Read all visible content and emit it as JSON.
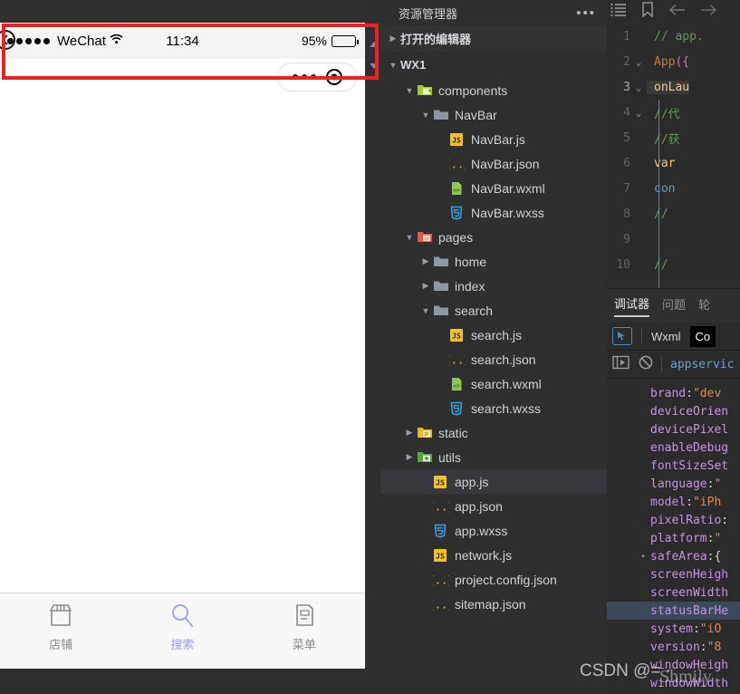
{
  "simulator": {
    "status_bar": {
      "signal_dots": 5,
      "carrier": "WeChat",
      "time": "11:34",
      "battery_percent": "95%",
      "battery_level": 0.95,
      "back_icon": "back-arrow-circle-icon",
      "wifi_icon": "wifi-icon"
    },
    "capsule": {
      "menu_icon": "more-dots-icon",
      "close_icon": "close-target-icon"
    },
    "tabbar": [
      {
        "label": "店铺",
        "icon": "shop-icon",
        "active": false
      },
      {
        "label": "搜索",
        "icon": "search-icon",
        "active": true
      },
      {
        "label": "菜单",
        "icon": "menu-doc-icon",
        "active": false
      }
    ]
  },
  "explorer": {
    "title": "资源管理器",
    "more_icon": "ellipsis-icon",
    "sections": [
      {
        "label": "打开的编辑器",
        "expanded": false
      },
      {
        "label": "WX1",
        "expanded": true
      }
    ],
    "tree": [
      {
        "label": "components",
        "type": "folder-green",
        "depth": 1,
        "expanded": true,
        "selected": false
      },
      {
        "label": "NavBar",
        "type": "folder-plain",
        "depth": 2,
        "expanded": true,
        "selected": false
      },
      {
        "label": "NavBar.js",
        "type": "js",
        "depth": 3,
        "selected": false
      },
      {
        "label": "NavBar.json",
        "type": "json",
        "depth": 3,
        "selected": false
      },
      {
        "label": "NavBar.wxml",
        "type": "wxml",
        "depth": 3,
        "selected": false
      },
      {
        "label": "NavBar.wxss",
        "type": "wxss",
        "depth": 3,
        "selected": false
      },
      {
        "label": "pages",
        "type": "folder-red",
        "depth": 1,
        "expanded": true,
        "selected": false
      },
      {
        "label": "home",
        "type": "folder-plain",
        "depth": 2,
        "expanded": false,
        "selected": false
      },
      {
        "label": "index",
        "type": "folder-plain",
        "depth": 2,
        "expanded": false,
        "selected": false
      },
      {
        "label": "search",
        "type": "folder-plain",
        "depth": 2,
        "expanded": true,
        "selected": false
      },
      {
        "label": "search.js",
        "type": "js",
        "depth": 3,
        "selected": false
      },
      {
        "label": "search.json",
        "type": "json",
        "depth": 3,
        "selected": false
      },
      {
        "label": "search.wxml",
        "type": "wxml",
        "depth": 3,
        "selected": false
      },
      {
        "label": "search.wxss",
        "type": "wxss",
        "depth": 3,
        "selected": false
      },
      {
        "label": "static",
        "type": "folder-yellow",
        "depth": 1,
        "expanded": false,
        "selected": false
      },
      {
        "label": "utils",
        "type": "folder-green2",
        "depth": 1,
        "expanded": false,
        "selected": false
      },
      {
        "label": "app.js",
        "type": "js",
        "depth": 2,
        "selected": true
      },
      {
        "label": "app.json",
        "type": "json",
        "depth": 2,
        "selected": false
      },
      {
        "label": "app.wxss",
        "type": "wxss",
        "depth": 2,
        "selected": false
      },
      {
        "label": "network.js",
        "type": "js",
        "depth": 2,
        "selected": false
      },
      {
        "label": "project.config.json",
        "type": "json",
        "depth": 2,
        "selected": false
      },
      {
        "label": "sitemap.json",
        "type": "json",
        "depth": 2,
        "selected": false
      }
    ]
  },
  "editor": {
    "toolbar_icons": [
      "outline-list-icon",
      "bookmark-icon",
      "back-arrow-icon",
      "forward-arrow-icon"
    ],
    "lines": [
      {
        "num": "1",
        "fold": "",
        "current": false,
        "tokens": [
          {
            "t": "// app.",
            "c": "k-comment"
          }
        ]
      },
      {
        "num": "2",
        "fold": "v",
        "current": false,
        "tokens": [
          {
            "t": "App",
            "c": "k-kw"
          },
          {
            "t": "({",
            "c": "k-brace"
          }
        ]
      },
      {
        "num": "3",
        "fold": "v",
        "current": true,
        "tokens": [
          {
            "t": "  onLau",
            "c": "k-fn"
          }
        ]
      },
      {
        "num": "4",
        "fold": "v",
        "current": false,
        "tokens": [
          {
            "t": "    //代",
            "c": "k-comment"
          }
        ]
      },
      {
        "num": "5",
        "fold": "",
        "current": false,
        "tokens": [
          {
            "t": "    //获",
            "c": "k-comment"
          }
        ]
      },
      {
        "num": "6",
        "fold": "",
        "current": false,
        "tokens": [
          {
            "t": "    var",
            "c": "k-fn"
          }
        ]
      },
      {
        "num": "7",
        "fold": "",
        "current": false,
        "tokens": [
          {
            "t": "    con",
            "c": "k-blue"
          }
        ]
      },
      {
        "num": "8",
        "fold": "",
        "current": false,
        "tokens": [
          {
            "t": "    // ",
            "c": "k-comment"
          }
        ]
      },
      {
        "num": "9",
        "fold": "",
        "current": false,
        "tokens": [
          {
            "t": "",
            "c": "k-plain"
          }
        ]
      },
      {
        "num": "10",
        "fold": "",
        "current": false,
        "tokens": [
          {
            "t": "    // ",
            "c": "k-comment"
          }
        ]
      }
    ]
  },
  "debugger": {
    "tabs": [
      {
        "label": "调试器",
        "active": true
      },
      {
        "label": "问题",
        "active": false
      },
      {
        "label": "轮",
        "active": false
      }
    ],
    "subbar": {
      "inspect_icon": "element-picker-icon",
      "items": [
        {
          "label": "Wxml",
          "selected": false
        },
        {
          "label": "Co",
          "selected": true
        }
      ]
    },
    "console_bar": {
      "step_icon": "step-into-icon",
      "clear_icon": "clear-console-icon",
      "context": "appservic"
    },
    "object_rows": [
      {
        "arrow": "",
        "key": "brand",
        "sep": ": ",
        "val": "\"dev",
        "valclass": "o-str",
        "highlight": false
      },
      {
        "arrow": "",
        "key": "deviceOrien",
        "sep": "",
        "val": "",
        "valclass": "o-str",
        "highlight": false
      },
      {
        "arrow": "",
        "key": "devicePixel",
        "sep": "",
        "val": "",
        "valclass": "o-str",
        "highlight": false
      },
      {
        "arrow": "",
        "key": "enableDebug",
        "sep": "",
        "val": "",
        "valclass": "o-str",
        "highlight": false
      },
      {
        "arrow": "",
        "key": "fontSizeSet",
        "sep": "",
        "val": "",
        "valclass": "o-str",
        "highlight": false
      },
      {
        "arrow": "",
        "key": "language",
        "sep": ": ",
        "val": "\"",
        "valclass": "o-str",
        "highlight": false
      },
      {
        "arrow": "",
        "key": "model",
        "sep": ": ",
        "val": "\"iPh",
        "valclass": "o-str",
        "highlight": false
      },
      {
        "arrow": "",
        "key": "pixelRatio",
        "sep": ":",
        "val": "",
        "valclass": "o-num",
        "highlight": false
      },
      {
        "arrow": "",
        "key": "platform",
        "sep": ": ",
        "val": "\"",
        "valclass": "o-str",
        "highlight": false
      },
      {
        "arrow": "▸",
        "key": "safeArea",
        "sep": ": ",
        "val": "{",
        "valclass": "o-punc",
        "highlight": false
      },
      {
        "arrow": "",
        "key": "screenHeigh",
        "sep": "",
        "val": "",
        "valclass": "o-num",
        "highlight": false
      },
      {
        "arrow": "",
        "key": "screenWidth",
        "sep": "",
        "val": "",
        "valclass": "o-num",
        "highlight": false
      },
      {
        "arrow": "",
        "key": "statusBarHe",
        "sep": "",
        "val": "",
        "valclass": "o-num",
        "highlight": true
      },
      {
        "arrow": "",
        "key": "system",
        "sep": ": ",
        "val": "\"iO",
        "valclass": "o-str",
        "highlight": false
      },
      {
        "arrow": "",
        "key": "version",
        "sep": ": ",
        "val": "\"8",
        "valclass": "o-str",
        "highlight": false
      },
      {
        "arrow": "",
        "key": "windowHeigh",
        "sep": "",
        "val": "",
        "valclass": "o-num",
        "highlight": false
      },
      {
        "arrow": "",
        "key": "windowWidth",
        "sep": "",
        "val": "",
        "valclass": "o-num",
        "highlight": false
      }
    ]
  },
  "annotation": {
    "rect_color": "#f31e1e"
  },
  "watermark": {
    "text": "CSDN @= ·",
    "text2": "Shmily"
  }
}
